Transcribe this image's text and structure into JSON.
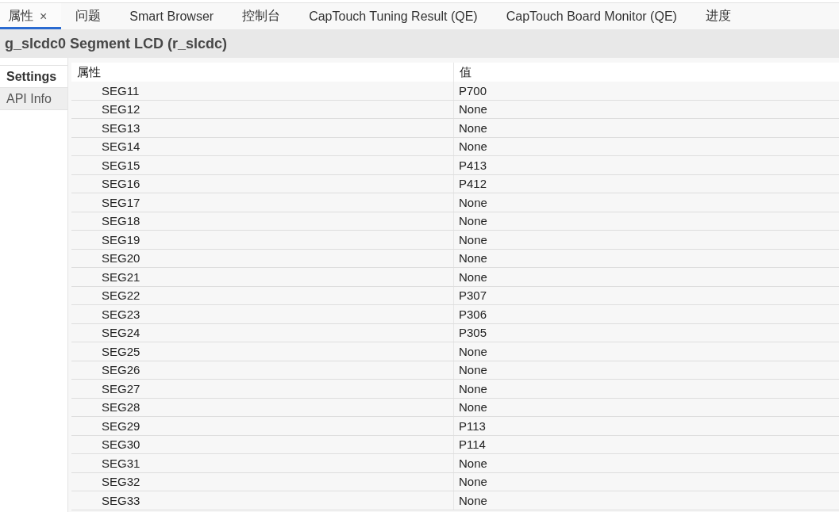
{
  "tabs": [
    {
      "label": "属性",
      "selected": true,
      "close": "×"
    },
    {
      "label": "问题",
      "selected": false
    },
    {
      "label": "Smart Browser",
      "selected": false
    },
    {
      "label": "控制台",
      "selected": false
    },
    {
      "label": "CapTouch Tuning Result (QE)",
      "selected": false
    },
    {
      "label": "CapTouch Board Monitor (QE)",
      "selected": false
    },
    {
      "label": "进度",
      "selected": false
    }
  ],
  "editor": {
    "title": "g_slcdc0 Segment LCD (r_slcdc)",
    "side_tabs": [
      {
        "label": "Settings",
        "selected": true
      },
      {
        "label": "API Info",
        "selected": false
      }
    ],
    "table": {
      "columns": [
        "属性",
        "值"
      ],
      "rows": [
        {
          "name": "SEG11",
          "value": "P700"
        },
        {
          "name": "SEG12",
          "value": "None"
        },
        {
          "name": "SEG13",
          "value": "None"
        },
        {
          "name": "SEG14",
          "value": "None"
        },
        {
          "name": "SEG15",
          "value": "P413"
        },
        {
          "name": "SEG16",
          "value": "P412"
        },
        {
          "name": "SEG17",
          "value": "None"
        },
        {
          "name": "SEG18",
          "value": "None"
        },
        {
          "name": "SEG19",
          "value": "None"
        },
        {
          "name": "SEG20",
          "value": "None"
        },
        {
          "name": "SEG21",
          "value": "None"
        },
        {
          "name": "SEG22",
          "value": "P307"
        },
        {
          "name": "SEG23",
          "value": "P306"
        },
        {
          "name": "SEG24",
          "value": "P305"
        },
        {
          "name": "SEG25",
          "value": "None"
        },
        {
          "name": "SEG26",
          "value": "None"
        },
        {
          "name": "SEG27",
          "value": "None"
        },
        {
          "name": "SEG28",
          "value": "None"
        },
        {
          "name": "SEG29",
          "value": "P113"
        },
        {
          "name": "SEG30",
          "value": "P114"
        },
        {
          "name": "SEG31",
          "value": "None"
        },
        {
          "name": "SEG32",
          "value": "None"
        },
        {
          "name": "SEG33",
          "value": "None"
        }
      ]
    }
  }
}
